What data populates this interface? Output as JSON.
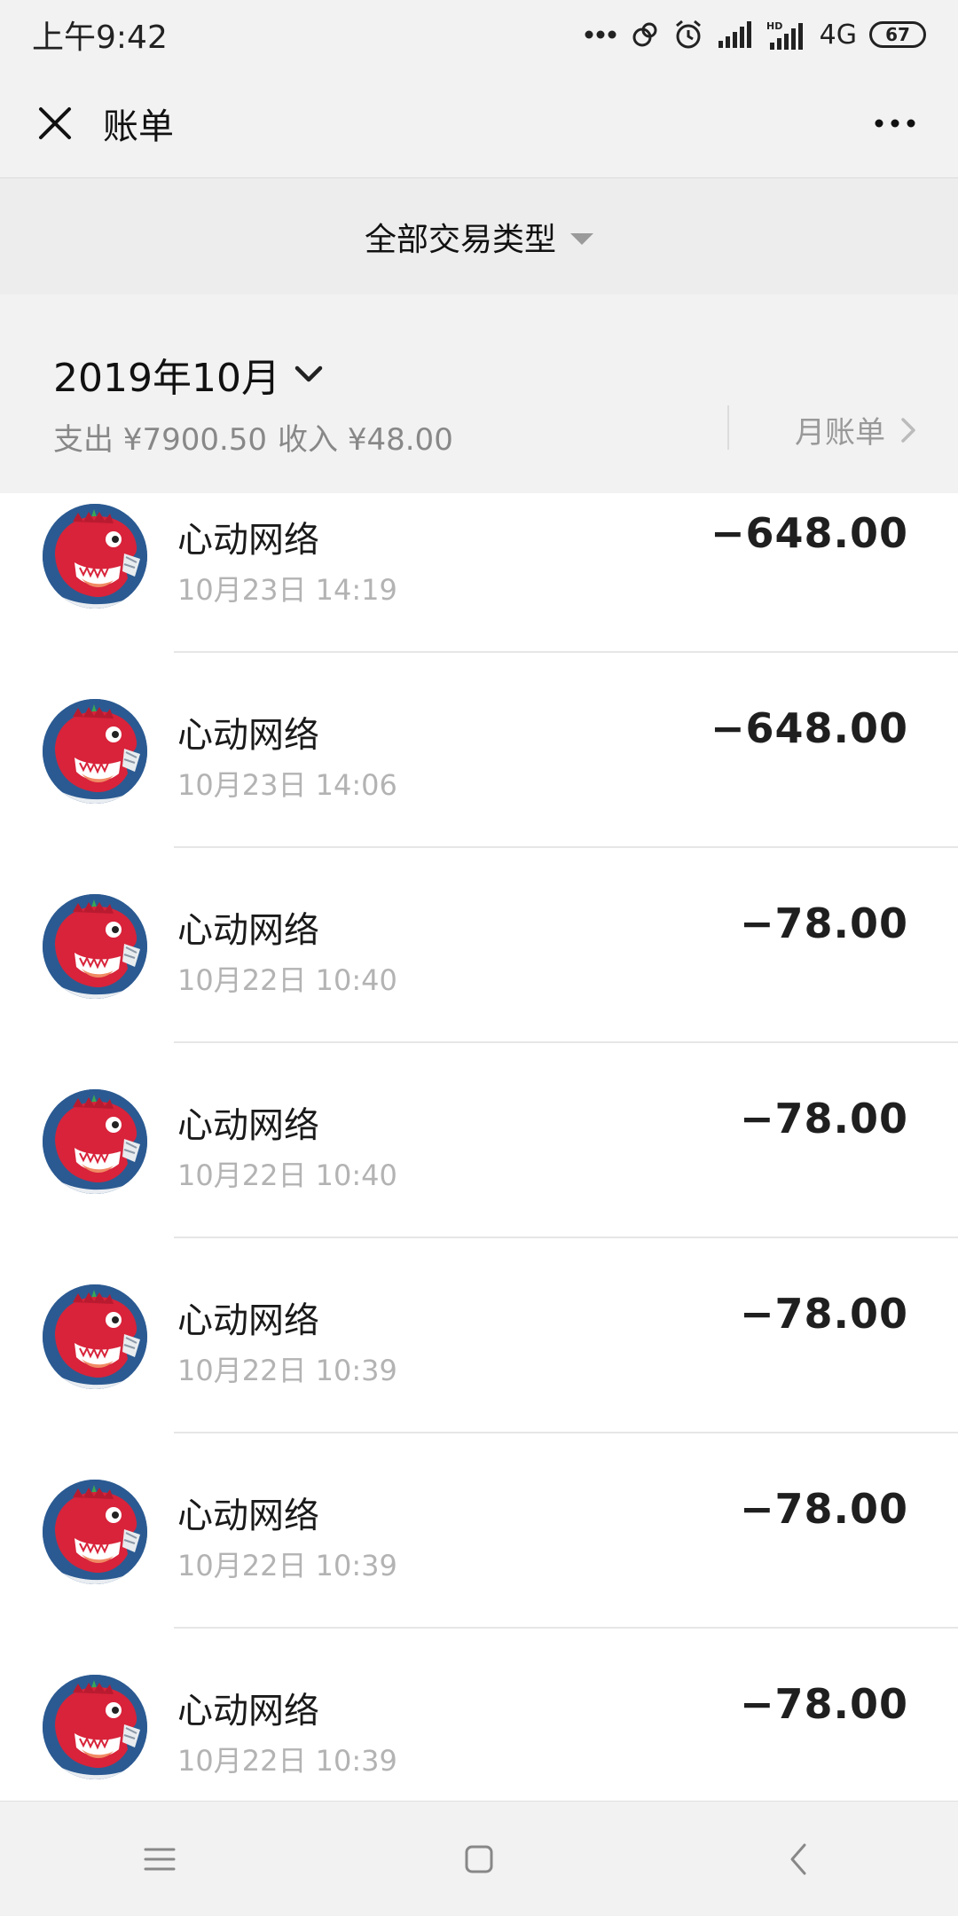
{
  "status_bar": {
    "time": "上午9:42",
    "network": "4G",
    "hd_label": "HD",
    "battery": "67"
  },
  "header": {
    "title": "账单"
  },
  "filter": {
    "label": "全部交易类型"
  },
  "month": {
    "label": "2019年10月",
    "expense_label": "支出 ¥7900.50",
    "income_label": "收入 ¥48.00",
    "monthly_bill": "月账单"
  },
  "transactions": [
    {
      "name": "心动网络",
      "time": "10月23日 14:19",
      "amount": "−648.00"
    },
    {
      "name": "心动网络",
      "time": "10月23日 14:06",
      "amount": "−648.00"
    },
    {
      "name": "心动网络",
      "time": "10月22日 10:40",
      "amount": "−78.00"
    },
    {
      "name": "心动网络",
      "time": "10月22日 10:40",
      "amount": "−78.00"
    },
    {
      "name": "心动网络",
      "time": "10月22日 10:39",
      "amount": "−78.00"
    },
    {
      "name": "心动网络",
      "time": "10月22日 10:39",
      "amount": "−78.00"
    },
    {
      "name": "心动网络",
      "time": "10月22日 10:39",
      "amount": "−78.00"
    }
  ],
  "icons": {
    "close": "close-icon",
    "more": "more-icon",
    "dropdown": "triangle-down-icon",
    "chevron": "chevron-down-icon",
    "arrow": "chevron-right-icon",
    "avatar": "dino-avatar-icon"
  },
  "colors": {
    "bar_background": "#f2f2f2",
    "amount": "#1f1f1f",
    "secondary_text": "#b3b3b3",
    "avatar_background": "#2b5a92",
    "avatar_dino": "#d8233a"
  }
}
